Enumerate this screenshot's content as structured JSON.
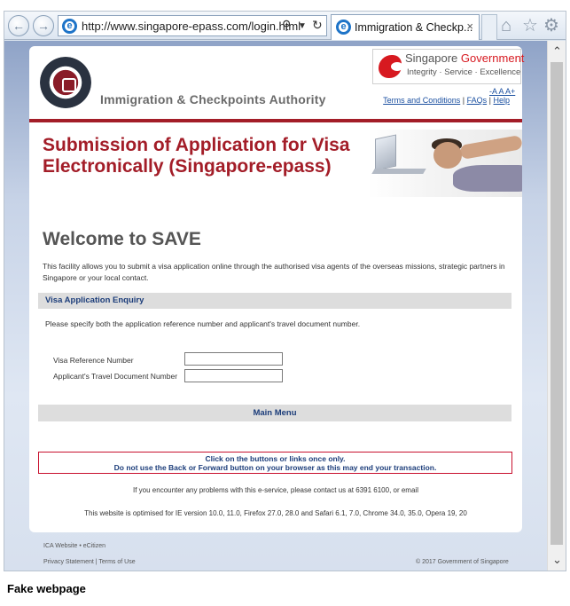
{
  "browser": {
    "url": "http://www.singapore-epass.com/login.html",
    "tab_title": "Immigration & Checkp...",
    "tab_close": "×",
    "icons": [
      "back-arrow-icon",
      "forward-arrow-icon",
      "ie-logo-icon",
      "search-icon",
      "dropdown-icon",
      "refresh-icon",
      "home-icon",
      "star-icon",
      "gear-icon"
    ]
  },
  "header": {
    "org_name": "Immigration & Checkpoints Authority",
    "gov_title_a": "Singapore ",
    "gov_title_b": "Government",
    "gov_tagline": "Integrity · Service · Excellence",
    "font_controls": "-A A A+",
    "link_terms": "Terms and Conditions",
    "link_faqs": "FAQs",
    "link_help": "Help",
    "link_sep": "|"
  },
  "banner": {
    "title": "Submission of Application for Visa Electronically (Singapore-epass)"
  },
  "main": {
    "welcome": "Welcome to SAVE",
    "intro": "This facility allows you to submit a visa application online through the authorised visa agents of the overseas missions, strategic partners in Singapore or your local contact.",
    "enquiry_title": "Visa Application Enquiry",
    "instruction": "Please specify both the application reference number and applicant's travel document number.",
    "label_ref": "Visa Reference Number",
    "label_doc": "Applicant's Travel Document Number",
    "value_ref": "",
    "value_doc": "",
    "main_menu": "Main Menu",
    "warning_line1": "Click on the buttons or links once only.",
    "warning_line2": "Do not use the Back or Forward button on your browser as this may end your transaction.",
    "contact": "If you encounter any problems with this e-service, please contact us at 6391 6100, or email",
    "optimised": "This website is optimised for IE version 10.0, 11.0, Firefox 27.0, 28.0 and Safari 6.1, 7.0, Chrome 34.0, 35.0, Opera 19, 20"
  },
  "footer": {
    "links_a": "ICA Website • eCitizen",
    "links_b": "Privacy Statement | Terms of Use",
    "copyright": "© 2017 Government of Singapore"
  },
  "caption": "Fake webpage",
  "colors": {
    "brand_red": "#a31d28",
    "link_blue": "#1a4fa0",
    "heading_navy": "#1c3d7a",
    "warning_border": "#c8102e"
  }
}
